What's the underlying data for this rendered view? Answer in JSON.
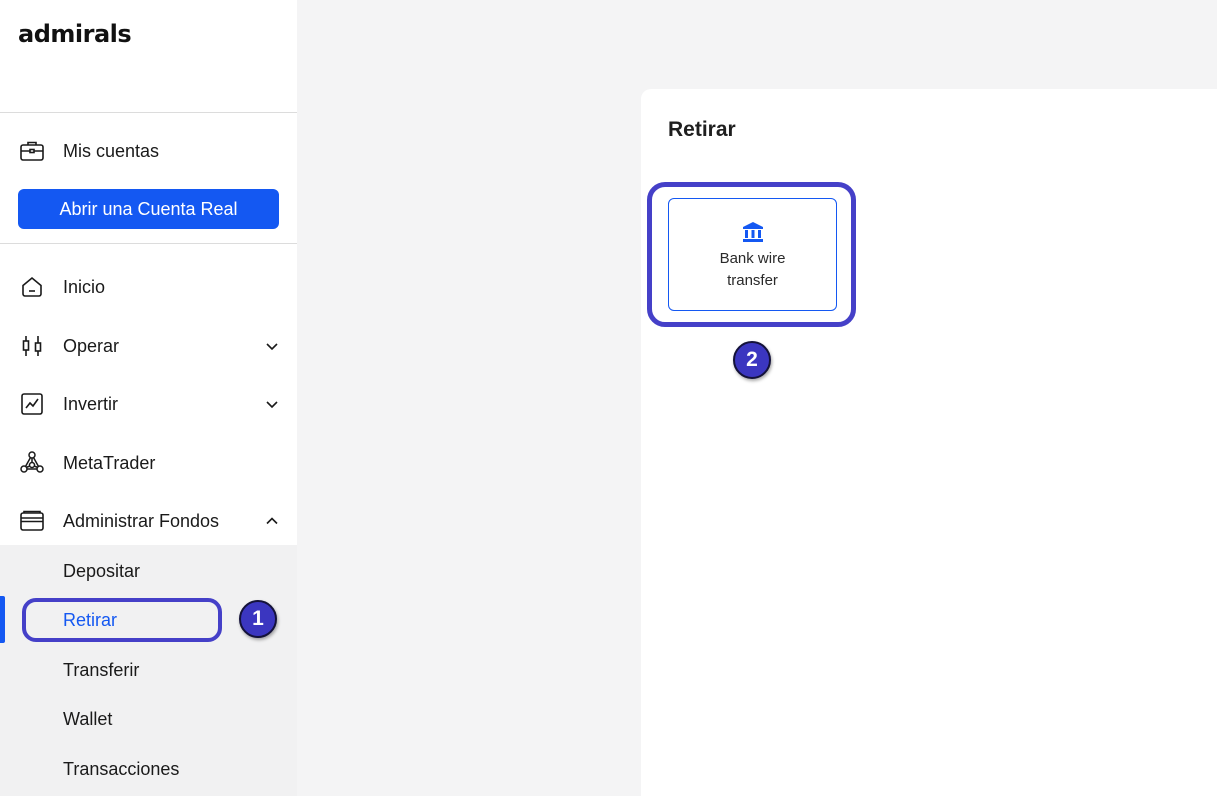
{
  "brand": {
    "logo_text": "admirals",
    "accent_color": "#1458f2",
    "annotation_color": "#4540c8"
  },
  "sidebar": {
    "account_item": {
      "label": "Mis cuentas",
      "icon": "briefcase-icon"
    },
    "cta_label": "Abrir una Cuenta Real",
    "items": [
      {
        "label": "Inicio",
        "icon": "home-icon",
        "expandable": false
      },
      {
        "label": "Operar",
        "icon": "candlestick-icon",
        "expandable": true,
        "expanded": false
      },
      {
        "label": "Invertir",
        "icon": "chart-line-icon",
        "expandable": true,
        "expanded": false
      },
      {
        "label": "MetaTrader",
        "icon": "metatrader-icon",
        "expandable": false
      },
      {
        "label": "Administrar Fondos",
        "icon": "wallet-icon",
        "expandable": true,
        "expanded": true
      }
    ],
    "submenu": [
      {
        "label": "Depositar"
      },
      {
        "label": "Retirar",
        "active": true
      },
      {
        "label": "Transferir"
      },
      {
        "label": "Wallet"
      },
      {
        "label": "Transacciones"
      }
    ]
  },
  "main": {
    "title": "Retirar",
    "methods": [
      {
        "label": "Bank wire transfer",
        "icon": "bank-icon"
      }
    ]
  },
  "annotations": [
    {
      "number": "1",
      "target": "Retirar"
    },
    {
      "number": "2",
      "target": "Bank wire transfer"
    }
  ]
}
